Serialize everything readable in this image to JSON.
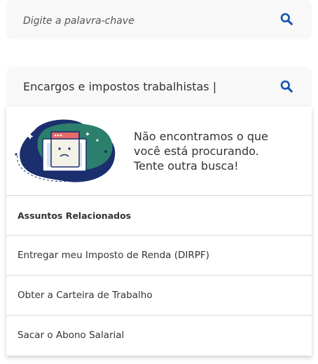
{
  "search_top": {
    "placeholder": "Digite a palavra-chave"
  },
  "search_active": {
    "query": "Encargos e impostos trabalhistas |"
  },
  "empty_state": {
    "message": "Não encontramos o que você está procurando. Tente outra busca!"
  },
  "related": {
    "title": "Assuntos Relacionados",
    "items": [
      "Entregar meu Imposto de Renda (DIRPF)",
      "Obter a Carteira de Trabalho",
      "Sacar o Abono Salarial"
    ]
  },
  "colors": {
    "accent": "#1351b4",
    "illustration_teal": "#2c7f6c",
    "illustration_navy": "#1b2f6e"
  },
  "icons": {
    "search": "search-icon"
  }
}
